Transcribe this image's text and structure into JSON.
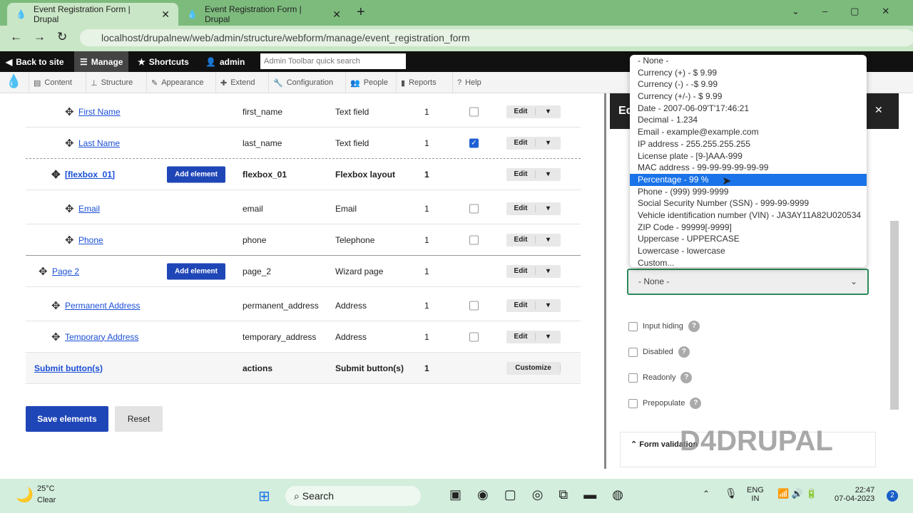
{
  "browser": {
    "tabs": [
      {
        "title": "Event Registration Form | Drupal"
      },
      {
        "title": "Event Registration Form | Drupal"
      }
    ],
    "url": "localhost/drupalnew/web/admin/structure/webform/manage/event_registration_form"
  },
  "toolbar": {
    "back": "Back to site",
    "manage": "Manage",
    "shortcuts": "Shortcuts",
    "user": "admin",
    "search_placeholder": "Admin Toolbar quick search"
  },
  "menu": [
    "Content",
    "Structure",
    "Appearance",
    "Extend",
    "Configuration",
    "People",
    "Reports",
    "Help"
  ],
  "rows": [
    {
      "title": "First Name",
      "key": "first_name",
      "type": "Text field",
      "weight": "1",
      "required": false
    },
    {
      "title": "Last Name",
      "key": "last_name",
      "type": "Text field",
      "weight": "1",
      "required": true
    },
    {
      "title": "[flexbox_01]",
      "key": "flexbox_01",
      "type": "Flexbox layout",
      "weight": "1",
      "add": "Add element"
    },
    {
      "title": "Email",
      "key": "email",
      "type": "Email",
      "weight": "1",
      "required": false
    },
    {
      "title": "Phone",
      "key": "phone",
      "type": "Telephone",
      "weight": "1",
      "required": false
    },
    {
      "title": "Page 2",
      "key": "page_2",
      "type": "Wizard page",
      "weight": "1",
      "add": "Add element"
    },
    {
      "title": "Permanent Address",
      "key": "permanent_address",
      "type": "Address",
      "weight": "1",
      "required": false
    },
    {
      "title": "Temporary Address",
      "key": "temporary_address",
      "type": "Address",
      "weight": "1",
      "required": false
    },
    {
      "title": "Submit button(s)",
      "key": "actions",
      "type": "Submit button(s)",
      "weight": "1",
      "action": "Customize"
    }
  ],
  "edit_label": "Edit",
  "buttons": {
    "save": "Save elements",
    "reset": "Reset"
  },
  "panel": {
    "title_partial": "Ed",
    "select_value": "- None -",
    "checkboxes": [
      "Input hiding",
      "Disabled",
      "Readonly",
      "Prepopulate"
    ],
    "section": "Form validation",
    "watermark": "D4DRUPAL"
  },
  "dropdown": {
    "selected_index": 10,
    "options": [
      "- None -",
      "Currency (+) - $ 9.99",
      "Currency (-) - -$ 9.99",
      "Currency (+/-) - $ 9.99",
      "Date - 2007-06-09'T'17:46:21",
      "Decimal - 1.234",
      "Email - example@example.com",
      "IP address - 255.255.255.255",
      "License plate - [9-]AAA-999",
      "MAC address - 99-99-99-99-99-99",
      "Percentage - 99 %",
      "Phone - (999) 999-9999",
      "Social Security Number (SSN) - 999-99-9999",
      "Vehicle identification number (VIN) - JA3AY11A82U020534",
      "ZIP Code - 99999[-9999]",
      "Uppercase - UPPERCASE",
      "Lowercase - lowercase",
      "Custom..."
    ]
  },
  "taskbar": {
    "temp": "25°C",
    "weather": "Clear",
    "search": "Search",
    "lang1": "ENG",
    "lang2": "IN",
    "time": "22:47",
    "date": "07-04-2023",
    "badge": "2"
  }
}
